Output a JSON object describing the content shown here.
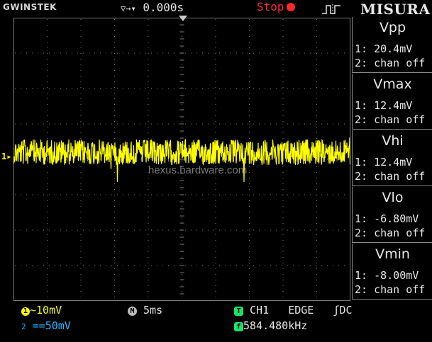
{
  "header": {
    "brand": "GWINSTEK",
    "time_delay": "0.000s",
    "run_state": "Stop",
    "panel_title": "MISURA"
  },
  "screen": {
    "watermark": "hexus.hardware.com",
    "ch1_marker": "1"
  },
  "measurements": [
    {
      "name": "Vpp",
      "ch1": "1: 20.4mV",
      "ch2": "2: chan off"
    },
    {
      "name": "Vmax",
      "ch1": "1: 12.4mV",
      "ch2": "2: chan off"
    },
    {
      "name": "Vhi",
      "ch1": "1: 12.4mV",
      "ch2": "2: chan off"
    },
    {
      "name": "Vlo",
      "ch1": "1: -6.80mV",
      "ch2": "2: chan off"
    },
    {
      "name": "Vmin",
      "ch1": "1: -8.00mV",
      "ch2": "2: chan off"
    }
  ],
  "footer": {
    "ch1_badge": "1",
    "ch1_coupling": "~",
    "ch1_scale": "10mV",
    "ch2_badge": "2",
    "ch2_coupling": "==",
    "ch2_scale": "50mV",
    "timebase_badge": "M",
    "timebase": "5ms",
    "trig_badge": "T",
    "trig_source": "CH1",
    "trig_type": "EDGE",
    "trig_slope_coupling": "ʃDC",
    "freq_badge": "f",
    "frequency": "584.480kHz"
  },
  "colors": {
    "ch1": "#ffff00",
    "ch2": "#00b4ff",
    "trigger": "#19e36a",
    "stop": "#ff2a2a",
    "grid": "#7a7a7a"
  }
}
